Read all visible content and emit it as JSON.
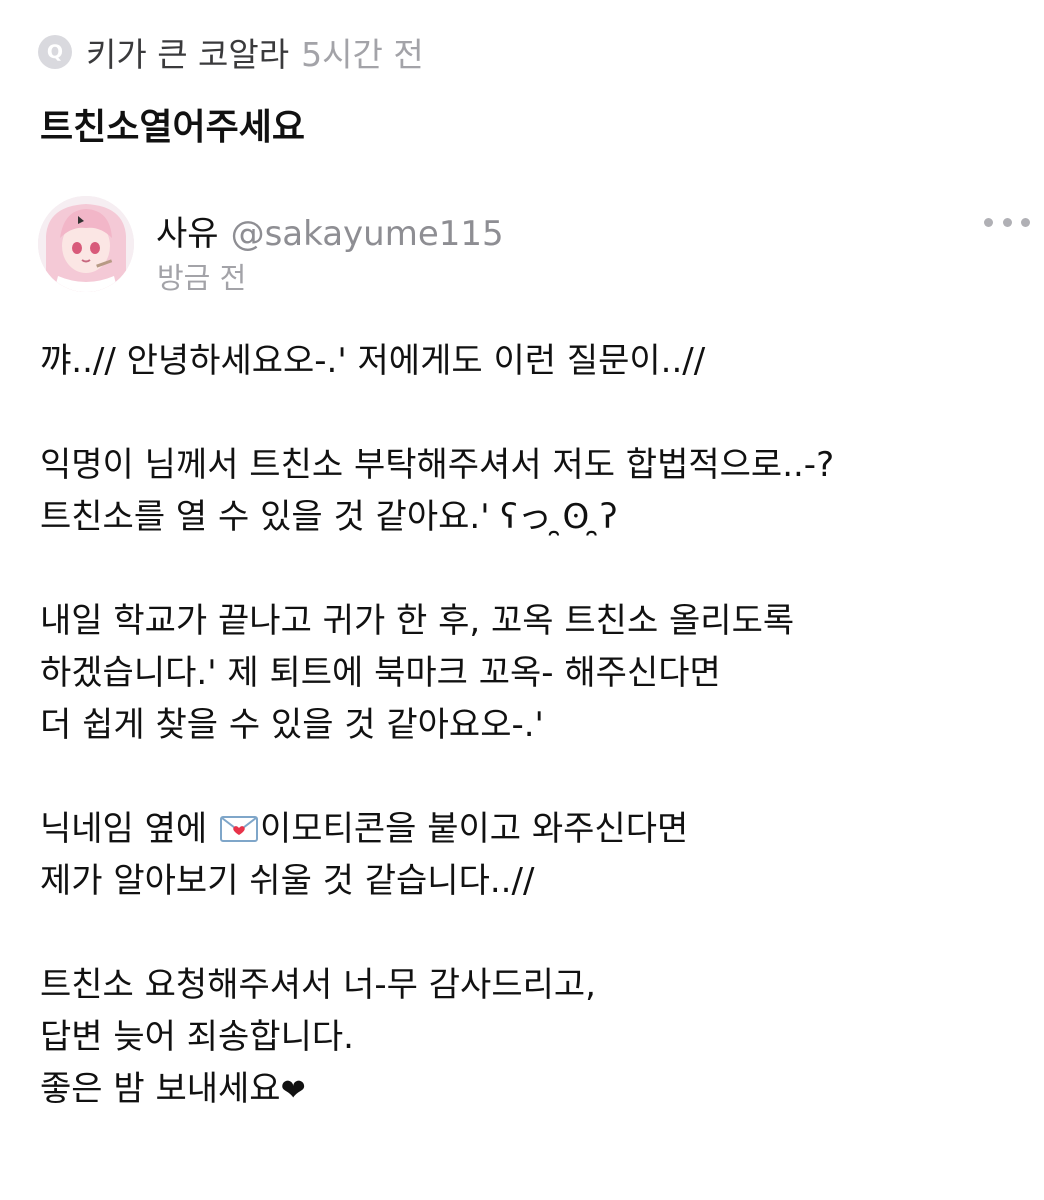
{
  "question": {
    "icon_letter": "Q",
    "author": "키가 큰 코알라",
    "time": "5시간 전",
    "text": "트친소열어주세요"
  },
  "answer": {
    "name": "사유",
    "handle": "@sakayume115",
    "time": "방금 전",
    "lines": {
      "l1": "꺄..// 안녕하세요오-.' 저에게도 이런 질문이..//",
      "l2": "익명이 님께서 트친소 부탁해주셔서 저도 합법적으로..-?",
      "l3": "트친소를 열 수 있을 것 같아요.' ʕっ ̯ʘ ̯ʔ",
      "l4": "내일 학교가 끝나고 귀가 한 후, 꼬옥 트친소 올리도록",
      "l5": "하겠습니다.' 제 퇴트에 북마크 꼬옥- 해주신다면",
      "l6": "더 쉽게 찾을 수 있을 것 같아요오-.'",
      "l7_before": "닉네임 옆에 ",
      "l7_after": "이모티콘을 붙이고 와주신다면",
      "l8": "제가 알아보기 쉬울 것 같습니다..//",
      "l9": "트친소 요청해주셔서 너-무 감사드리고,",
      "l10": "답변 늦어 죄송합니다.",
      "l11_text": "좋은 밤 보내세요",
      "l11_heart": "❤"
    },
    "emoji_name": "love-letter-icon"
  }
}
